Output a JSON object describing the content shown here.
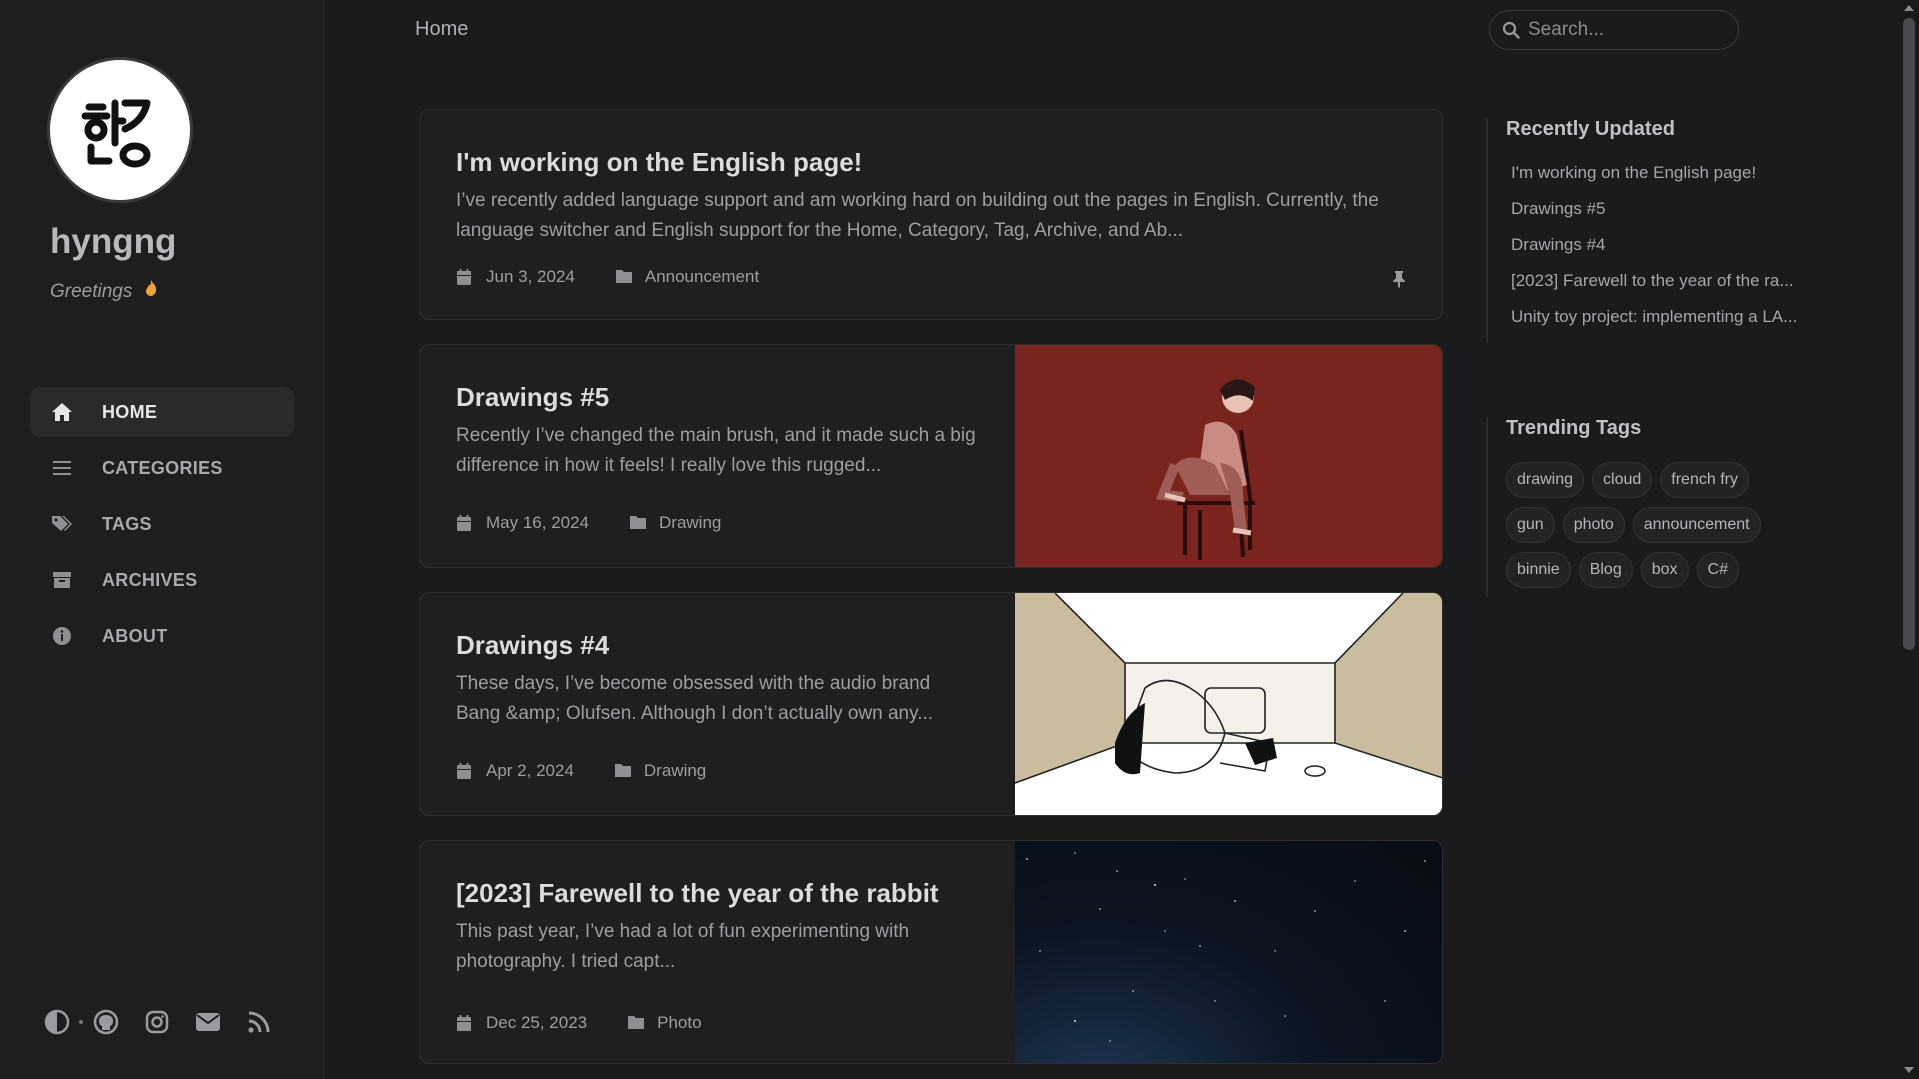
{
  "sidebar": {
    "avatar_glyph": "헝",
    "title": "hyngng",
    "subtitle": "Greetings",
    "nav": [
      {
        "label": "HOME",
        "icon": "home-icon",
        "active": true
      },
      {
        "label": "CATEGORIES",
        "icon": "list-icon",
        "active": false
      },
      {
        "label": "TAGS",
        "icon": "tags-icon",
        "active": false
      },
      {
        "label": "ARCHIVES",
        "icon": "archive-icon",
        "active": false
      },
      {
        "label": "ABOUT",
        "icon": "info-icon",
        "active": false
      }
    ],
    "bottom_icons": [
      "theme-toggle-icon",
      "github-icon",
      "instagram-icon",
      "email-icon",
      "rss-icon"
    ]
  },
  "topbar": {
    "breadcrumb": "Home",
    "search_placeholder": "Search..."
  },
  "posts": [
    {
      "title": "I'm working on the English page!",
      "excerpt": "I’ve recently added language support and am working hard on building out the pages in English. Currently, the language switcher and English support for the Home, Category, Tag, Archive, and Ab...",
      "date": "Jun 3, 2024",
      "category": "Announcement",
      "pinned": true
    },
    {
      "title": "Drawings #5",
      "excerpt": "Recently I’ve changed the main brush, and it made such a big difference in how it feels! I really love this rugged...",
      "date": "May 16, 2024",
      "category": "Drawing",
      "image": "red-illustration"
    },
    {
      "title": "Drawings #4",
      "excerpt": "These days, I’ve become obsessed with the audio brand Bang &amp; Olufsen. Although I don’t actually own any...",
      "date": "Apr 2, 2024",
      "category": "Drawing",
      "image": "beige-sketch"
    },
    {
      "title": "[2023] Farewell to the year of the rabbit",
      "excerpt": "This past year, I’ve had a lot of fun experimenting with photography. I tried capt...",
      "date": "Dec 25, 2023",
      "category": "Photo",
      "image": "night-sky"
    }
  ],
  "panel": {
    "recent_heading": "Recently Updated",
    "recent": [
      "I'm working on the English page!",
      "Drawings #5",
      "Drawings #4",
      "[2023] Farewell to the year of the ra...",
      "Unity toy project: implementing a LA..."
    ],
    "tags_heading": "Trending Tags",
    "tags": [
      "drawing",
      "cloud",
      "french fry",
      "gun",
      "photo",
      "announcement",
      "binnie",
      "Blog",
      "box",
      "C#"
    ]
  },
  "colors": {
    "background": "#1b1b1e",
    "sidebar": "#1e1e20",
    "card": "#1f1f21",
    "red_image": "#7a241f",
    "beige_image": "#c9bc9f"
  }
}
